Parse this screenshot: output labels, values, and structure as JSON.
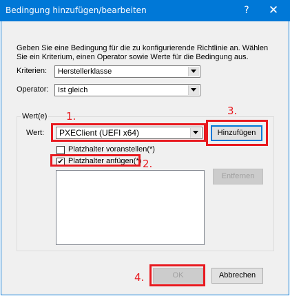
{
  "window": {
    "title": "Bedingung hinzufügen/bearbeiten",
    "help_glyph": "?",
    "close_glyph": "✕"
  },
  "description": "Geben Sie eine Bedingung für die zu konfigurierende Richtlinie an. Wählen Sie ein Kriterium, einen Operator sowie Werte für die Bedingung aus.",
  "criteria": {
    "label": "Kriterien:",
    "value": "Herstellerklasse"
  },
  "operator": {
    "label": "Operator:",
    "value": "Ist gleich"
  },
  "values_group": {
    "title": "Wert(e)",
    "value_label": "Wert:",
    "value": "PXEClient (UEFI x64)",
    "add_button": "Hinzufügen",
    "prefix_placeholder": {
      "label": "Platzhalter voranstellen(*)",
      "checked": false
    },
    "append_placeholder": {
      "label": "Platzhalter anfügen(*)",
      "checked": true
    },
    "remove_button": "Entfernen",
    "list_items": []
  },
  "buttons": {
    "ok": "OK",
    "cancel": "Abbrechen"
  },
  "annotations": {
    "step1": "1.",
    "step2": "2.",
    "step3": "3.",
    "step4": "4."
  },
  "colors": {
    "titlebar": "#0078d7",
    "annotation_red": "#e8191f",
    "dialog_bg": "#f0f0f0"
  }
}
